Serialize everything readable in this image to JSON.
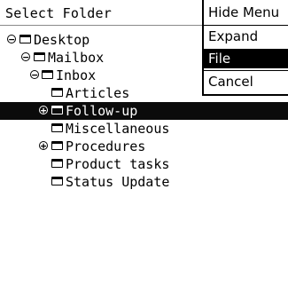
{
  "header": {
    "title": "Select Folder"
  },
  "tree": {
    "items": [
      {
        "label": "Desktop",
        "expander": "minus"
      },
      {
        "label": "Mailbox",
        "expander": "minus"
      },
      {
        "label": "Inbox",
        "expander": "minus"
      },
      {
        "label": "Articles",
        "expander": ""
      },
      {
        "label": "Follow-up",
        "expander": "plus",
        "selected": true
      },
      {
        "label": "Miscellaneous",
        "expander": ""
      },
      {
        "label": "Procedures",
        "expander": "plus"
      },
      {
        "label": "Product tasks",
        "expander": ""
      },
      {
        "label": "Status Update",
        "expander": ""
      }
    ]
  },
  "menu": {
    "items": [
      {
        "label": "Hide Menu"
      },
      {
        "label": "Expand"
      },
      {
        "label": "File",
        "active": true
      },
      {
        "label": "Cancel"
      }
    ]
  }
}
